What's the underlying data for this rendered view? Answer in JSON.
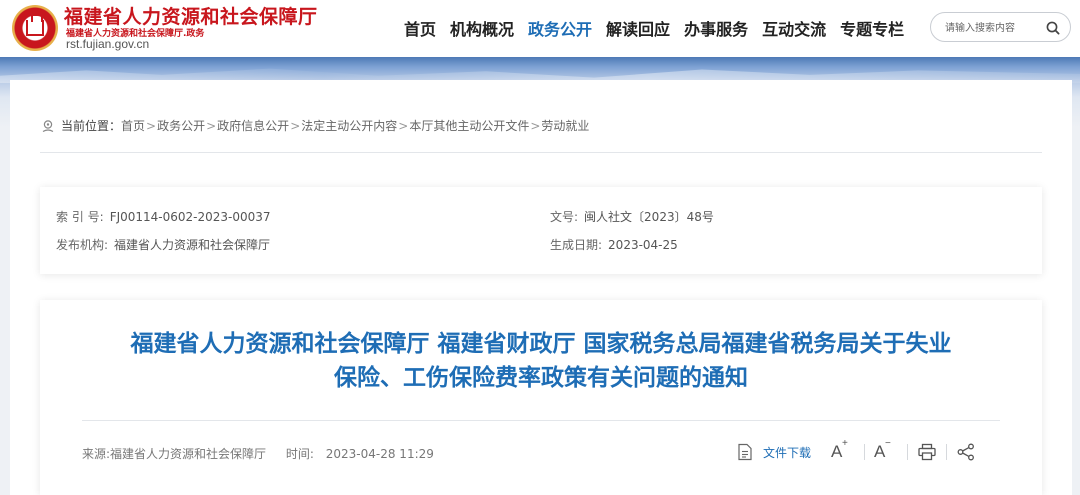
{
  "header": {
    "site_title": "福建省人力资源和社会保障厅",
    "site_subtitle": "福建省人力资源和社会保障厅.政务",
    "domain": "rst.fujian.gov.cn",
    "nav": [
      {
        "label": "首页",
        "active": false
      },
      {
        "label": "机构概况",
        "active": false
      },
      {
        "label": "政务公开",
        "active": true
      },
      {
        "label": "解读回应",
        "active": false
      },
      {
        "label": "办事服务",
        "active": false
      },
      {
        "label": "互动交流",
        "active": false
      },
      {
        "label": "专题专栏",
        "active": false
      }
    ],
    "search": {
      "placeholder": "请输入搜索内容",
      "icon": "search-icon"
    }
  },
  "breadcrumb": {
    "label": "当前位置：",
    "items": [
      "首页",
      "政务公开",
      "政府信息公开",
      "法定主动公开内容",
      "本厅其他主动公开文件",
      "劳动就业"
    ],
    "separator": ">"
  },
  "meta": {
    "index_label": "索 引 号:",
    "index_value": "FJ00114-0602-2023-00037",
    "doc_no_label": "文号:",
    "doc_no_value": "闽人社文〔2023〕48号",
    "publisher_label": "发布机构:",
    "publisher_value": "福建省人力资源和社会保障厅",
    "date_label": "生成日期:",
    "date_value": "2023-04-25"
  },
  "article": {
    "title_line1": "福建省人力资源和社会保障厅 福建省财政厅 国家税务总局福建省税务局关于失业",
    "title_line2": "保险、工伤保险费率政策有关问题的通知",
    "source": "来源:福建省人力资源和社会保障厅",
    "time_label": "时间:",
    "time_value": "2023-04-28 11:29",
    "download_label": "文件下载",
    "font_up": "A",
    "font_up_sup": "+",
    "font_down": "A",
    "font_down_sup": "−"
  },
  "colors": {
    "brand_red": "#c8161d",
    "accent_blue": "#1e6db5"
  }
}
